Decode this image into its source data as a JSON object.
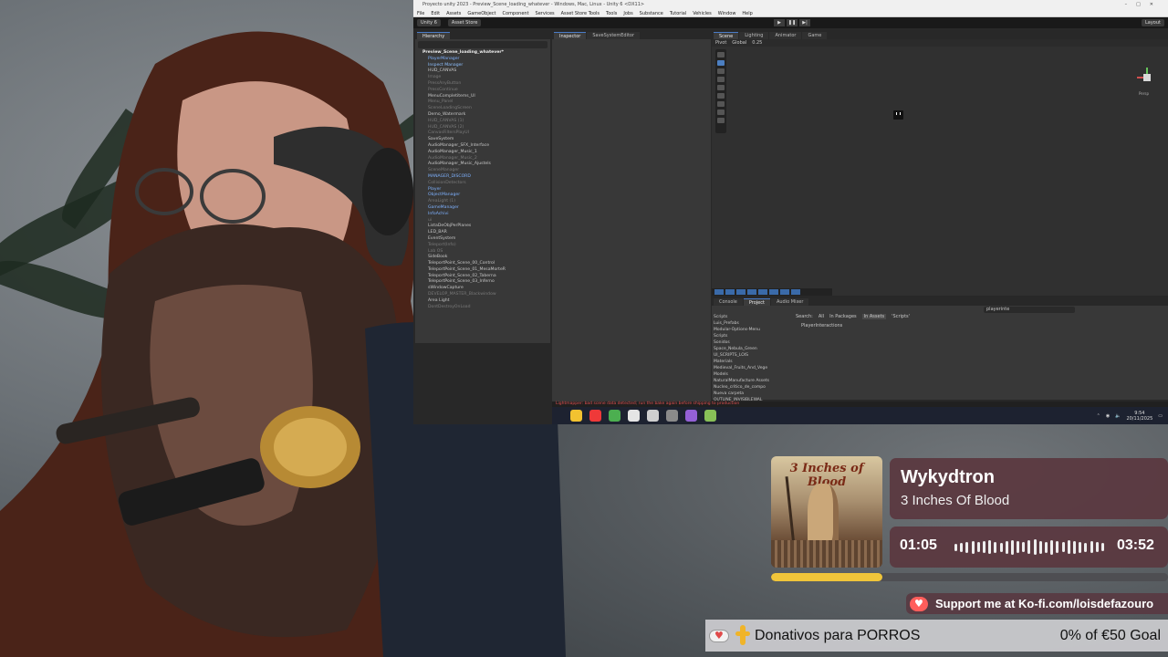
{
  "unity": {
    "title": "Proyecto unity 2023 - Preview_Scene_loading_whatever - Windows, Mac, Linux - Unity 6 <DX11>",
    "menus": [
      "File",
      "Edit",
      "Assets",
      "GameObject",
      "Component",
      "Services",
      "Asset Store Tools",
      "Tools",
      "Jobs",
      "Substance",
      "Tutorial",
      "Vehicles",
      "Window",
      "Help"
    ],
    "toolbar": {
      "account": "Unity 6",
      "asset_store": "Asset Store",
      "layout": "Layout"
    },
    "hierarchy": {
      "tab": "Hierarchy",
      "items": [
        {
          "label": "Preview_Scene_loading_whatever*",
          "style": "root"
        },
        {
          "label": "PlayerManager",
          "style": "blue"
        },
        {
          "label": "Inspect Manager",
          "style": "sel"
        },
        {
          "label": "HUD_CANVAS",
          "style": ""
        },
        {
          "label": "Image",
          "style": "dim"
        },
        {
          "label": "PressAnyButton",
          "style": "dim"
        },
        {
          "label": "PressContinue",
          "style": "dim"
        },
        {
          "label": "MenuCompletitems_UI",
          "style": ""
        },
        {
          "label": "Menu_Panel",
          "style": "dim"
        },
        {
          "label": "SceneLoadingScreen",
          "style": "dim"
        },
        {
          "label": "Demo_Watermark",
          "style": ""
        },
        {
          "label": "HUD_CANVAS (1)",
          "style": "dim"
        },
        {
          "label": "HUD_CANVAS (2)",
          "style": "dim"
        },
        {
          "label": "CanvasFiltersPlayUI",
          "style": "dim"
        },
        {
          "label": "SaveSystem",
          "style": ""
        },
        {
          "label": "AudioManager_SFX_Interface",
          "style": ""
        },
        {
          "label": "AudioManager_Music_1",
          "style": ""
        },
        {
          "label": "AudioManager_Music_2",
          "style": "dim"
        },
        {
          "label": "AudioManager_Music_Ajustels",
          "style": ""
        },
        {
          "label": "SceneManager",
          "style": "dim"
        },
        {
          "label": "MANAGER_DISCORD",
          "style": "blue"
        },
        {
          "label": "CollisionDetectors",
          "style": "dim"
        },
        {
          "label": "Player",
          "style": "blue"
        },
        {
          "label": "ObjectManager",
          "style": "blue"
        },
        {
          "label": "AreaLight (1)",
          "style": "dim"
        },
        {
          "label": "GameManager",
          "style": "blue"
        },
        {
          "label": "InfoAchivi",
          "style": "blue"
        },
        {
          "label": "ui",
          "style": "dim"
        },
        {
          "label": "ListaDeObjPerPlanes",
          "style": ""
        },
        {
          "label": "LED_BAR",
          "style": ""
        },
        {
          "label": "EventSystem",
          "style": ""
        },
        {
          "label": "Teleport(Info)",
          "style": "dim"
        },
        {
          "label": "Lab OS",
          "style": "dim"
        },
        {
          "label": "SideBook",
          "style": ""
        },
        {
          "label": "TeleportPoint_Scene_00_Control",
          "style": ""
        },
        {
          "label": "TeleportPoint_Scene_01_MesaMorteR",
          "style": ""
        },
        {
          "label": "TeleportPoint_Scene_02_Taberna",
          "style": ""
        },
        {
          "label": "TeleportPoint_Scene_03_Inferno",
          "style": ""
        },
        {
          "label": "sWindowCapture",
          "style": ""
        },
        {
          "label": "DEVELOP_MASTER_Blackwindow",
          "style": "dim"
        },
        {
          "label": "Area Light",
          "style": ""
        },
        {
          "label": "DontDestroyOnLoad",
          "style": "dim"
        }
      ]
    },
    "inspector": {
      "tab": "Inspector",
      "tab2": "SaveSystemEditor"
    },
    "scene": {
      "tabs": [
        "Scene",
        "Lighting",
        "Animator",
        "Game"
      ],
      "pivot": "Pivot",
      "global": "Global",
      "snap": "0.25",
      "persp": "Persp"
    },
    "project": {
      "tabs": [
        "Console",
        "Project",
        "Audio Mixer"
      ],
      "tree": [
        "Scripts",
        "Luis_Prefabs",
        "Modular-Options-Menu",
        "Scripts",
        "Sonidos",
        "Space_Nebula_Green",
        "UI_SCRIPTS_LOIS",
        "Materials",
        "Medieval_Fruits_And_Vege",
        "Models",
        "NaturalManufacture Assets",
        "Nucleo_critico_de_compo",
        "Nueva carpeta",
        "OUTLINE_INVISIBLEWAL"
      ],
      "filters": [
        "Search:",
        "All",
        "In Packages",
        "In Assets",
        "'Scripts'"
      ],
      "active_filter": "In Assets",
      "result": "PlayerInteractions",
      "search_value": "playerinte"
    },
    "status": "Lightmapper: bad scene data detected; run the bake again before shipping to production"
  },
  "taskbar": {
    "apps": [
      {
        "name": "file-explorer-icon",
        "color": "#f2c230"
      },
      {
        "name": "vivaldi-icon",
        "color": "#ef3939"
      },
      {
        "name": "chrome-icon",
        "color": "#4caf50"
      },
      {
        "name": "obs-icon",
        "color": "#e5e5e5"
      },
      {
        "name": "unity-icon",
        "color": "#cfcfcf"
      },
      {
        "name": "discord-icon",
        "color": "#8a8a8a"
      },
      {
        "name": "visual-studio-icon",
        "color": "#9460d6"
      },
      {
        "name": "notepad-icon",
        "color": "#88c057"
      }
    ],
    "time": "9:54",
    "date": "20/11/2025"
  },
  "music": {
    "artist": "Wykydtron",
    "album": "3 Inches Of Blood",
    "cover_text": "3 Inches of Blood",
    "elapsed": "01:05",
    "total": "03:52",
    "progress": 0.28,
    "accent": "#f0c53a"
  },
  "kofi": {
    "text": "Support me at Ko-fi.com/loisdefazouro"
  },
  "donation": {
    "label": "Donativos para PORROS",
    "goal": "0% of €50 Goal"
  }
}
